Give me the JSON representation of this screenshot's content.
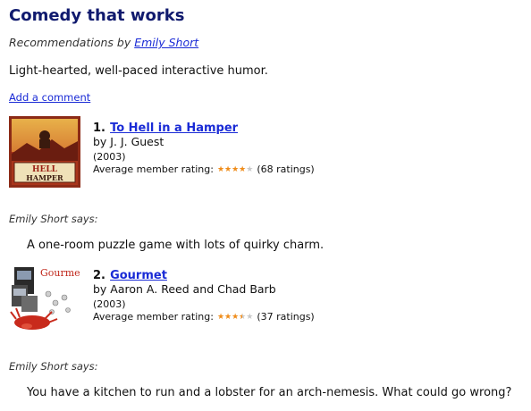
{
  "header": {
    "title": "Comedy that works",
    "byline_prefix": "Recommendations by",
    "author": "Emily Short",
    "description": "Light-hearted, well-paced interactive humor.",
    "add_comment": "Add a comment"
  },
  "items": [
    {
      "number": "1.",
      "title": "To Hell in a Hamper",
      "author": "by J. J. Guest",
      "year": "(2003)",
      "rating_label": "Average member rating:",
      "rating_value": 4,
      "rating_count": "(68 ratings)",
      "cover_text_1": "HELL",
      "cover_text_2": "HAMPER",
      "says": "Emily Short says:",
      "comment": "A one-room puzzle game with lots of quirky charm."
    },
    {
      "number": "2.",
      "title": "Gourmet",
      "author": "by Aaron A. Reed and Chad Barb",
      "year": "(2003)",
      "rating_label": "Average member rating:",
      "rating_value": 3.5,
      "rating_count": "(37 ratings)",
      "cover_text_1": "Gourmet",
      "says": "Emily Short says:",
      "comment": "You have a kitchen to run and a lobster for an arch-nemesis. What could go wrong?"
    }
  ]
}
